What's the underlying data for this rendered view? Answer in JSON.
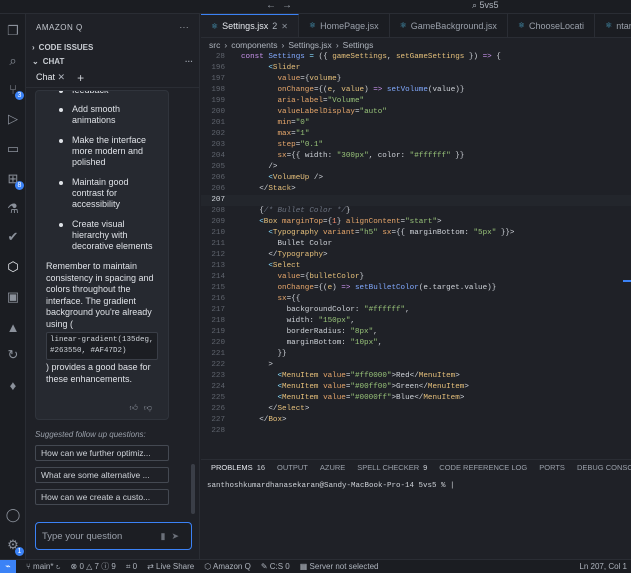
{
  "titlebar": {
    "search": "5vs5",
    "nav_back": "←",
    "nav_fwd": "→"
  },
  "sidebar": {
    "title": "AMAZON Q",
    "sections": [
      {
        "label": "CODE ISSUES"
      },
      {
        "label": "CHAT"
      }
    ],
    "chat_tab": "Chat"
  },
  "chat": {
    "bullets_partial": "feedback",
    "bullets": [
      "Add smooth animations",
      "Make the interface more modern and polished",
      "Maintain good contrast for accessibility",
      "Create visual hierarchy with decorative elements"
    ],
    "paragraph1": "Remember to maintain consistency in spacing and colors throughout the interface. The gradient background you're already using (",
    "code": "linear-gradient(135deg, #263550, #AF47D2)",
    "paragraph2": ") provides a good base for these enhancements.",
    "suggest_label": "Suggested follow up questions:",
    "suggestions": [
      "How can we further optimiz...",
      "What are some alternative ...",
      "How can we create a custo..."
    ],
    "input_placeholder": "Type your question"
  },
  "editor": {
    "tabs": [
      {
        "label": "Settings.jsx",
        "badge": "2",
        "active": true
      },
      {
        "label": "HomePage.jsx"
      },
      {
        "label": "GameBackground.jsx"
      },
      {
        "label": "ChooseLocati"
      },
      {
        "label": "ntary.jsx"
      }
    ],
    "breadcrumb": [
      "src",
      "components",
      "Settings.jsx",
      "Settings"
    ],
    "lines": [
      {
        "n": "28",
        "html": "<span class=\"kw\">const</span> <span class=\"fn\">Settings</span> <span class=\"pn\">=</span> ({ <span class=\"va\">gameSettings</span>, <span class=\"va\">setGameSettings</span> }) <span class=\"kw\">=&gt;</span> {"
      },
      {
        "n": "196",
        "html": "      <span class=\"pn\">&lt;</span><span class=\"tg\">Slider</span>"
      },
      {
        "n": "197",
        "html": "        <span class=\"at\">value</span>={<span class=\"va\">volume</span>}"
      },
      {
        "n": "198",
        "html": "        <span class=\"at\">onChange</span>={(<span class=\"va\">e</span>, <span class=\"va\">value</span>) <span class=\"kw\">=&gt;</span> <span class=\"fn\">setVolume</span>(value)}"
      },
      {
        "n": "199",
        "html": "        <span class=\"at\">aria-label</span>=<span class=\"st\">\"Volume\"</span>"
      },
      {
        "n": "200",
        "html": "        <span class=\"at\">valueLabelDisplay</span>=<span class=\"st\">\"auto\"</span>"
      },
      {
        "n": "201",
        "html": "        <span class=\"at\">min</span>=<span class=\"st\">\"0\"</span>"
      },
      {
        "n": "202",
        "html": "        <span class=\"at\">max</span>=<span class=\"st\">\"1\"</span>"
      },
      {
        "n": "203",
        "html": "        <span class=\"at\">step</span>=<span class=\"st\">\"0.1\"</span>"
      },
      {
        "n": "204",
        "html": "        <span class=\"at\">sx</span>={{ width: <span class=\"st\">\"300px\"</span>, color: <span class=\"st\">\"#ffffff\"</span> }}"
      },
      {
        "n": "205",
        "html": "      /&gt;"
      },
      {
        "n": "206",
        "html": "      <span class=\"pn\">&lt;</span><span class=\"tg\">VolumeUp</span> /&gt;"
      },
      {
        "n": "206",
        "html": "    &lt;/<span class=\"tg\">Stack</span>&gt;"
      },
      {
        "n": "207",
        "html": "",
        "cur": true
      },
      {
        "n": "208",
        "html": "    {<span class=\"cm\">/* Bullet Color */</span>}"
      },
      {
        "n": "209",
        "html": "    <span class=\"pn\">&lt;</span><span class=\"tg\">Box</span> <span class=\"at\">marginTop</span>={<span class=\"br\">1</span>} <span class=\"at\">alignContent</span>=<span class=\"st\">\"start\"</span>&gt;"
      },
      {
        "n": "210",
        "html": "      <span class=\"pn\">&lt;</span><span class=\"tg\">Typography</span> <span class=\"at\">variant</span>=<span class=\"st\">\"h5\"</span> <span class=\"at\">sx</span>={{ marginBottom: <span class=\"st\">\"5px\"</span> }}&gt;"
      },
      {
        "n": "211",
        "html": "        Bullet Color"
      },
      {
        "n": "212",
        "html": "      &lt;/<span class=\"tg\">Typography</span>&gt;"
      },
      {
        "n": "213",
        "html": "      <span class=\"pn\">&lt;</span><span class=\"tg\">Select</span>"
      },
      {
        "n": "214",
        "html": "        <span class=\"at\">value</span>={<span class=\"va\">bulletColor</span>}"
      },
      {
        "n": "215",
        "html": "        <span class=\"at\">onChange</span>={(<span class=\"va\">e</span>) <span class=\"kw\">=&gt;</span> <span class=\"fn\">setBulletColor</span>(e.target.value)}"
      },
      {
        "n": "216",
        "html": "        <span class=\"at\">sx</span>={{"
      },
      {
        "n": "217",
        "html": "          backgroundColor: <span class=\"st\">\"#ffffff\"</span>,"
      },
      {
        "n": "218",
        "html": "          width: <span class=\"st\">\"150px\"</span>,"
      },
      {
        "n": "219",
        "html": "          borderRadius: <span class=\"st\">\"8px\"</span>,"
      },
      {
        "n": "220",
        "html": "          marginBottom: <span class=\"st\">\"10px\"</span>,"
      },
      {
        "n": "221",
        "html": "        }}"
      },
      {
        "n": "222",
        "html": "      &gt;"
      },
      {
        "n": "223",
        "html": "        <span class=\"pn\">&lt;</span><span class=\"tg\">MenuItem</span> <span class=\"at\">value</span>=<span class=\"st\">\"#ff0000\"</span>&gt;Red&lt;/<span class=\"tg\">MenuItem</span>&gt;"
      },
      {
        "n": "224",
        "html": "        <span class=\"pn\">&lt;</span><span class=\"tg\">MenuItem</span> <span class=\"at\">value</span>=<span class=\"st\">\"#00ff00\"</span>&gt;Green&lt;/<span class=\"tg\">MenuItem</span>&gt;"
      },
      {
        "n": "225",
        "html": "        <span class=\"pn\">&lt;</span><span class=\"tg\">MenuItem</span> <span class=\"at\">value</span>=<span class=\"st\">\"#0000ff\"</span>&gt;Blue&lt;/<span class=\"tg\">MenuItem</span>&gt;"
      },
      {
        "n": "226",
        "html": "      &lt;/<span class=\"tg\">Select</span>&gt;"
      },
      {
        "n": "227",
        "html": "    &lt;/<span class=\"tg\">Box</span>&gt;"
      },
      {
        "n": "228",
        "html": ""
      }
    ]
  },
  "panel": {
    "tabs": [
      {
        "label": "PROBLEMS",
        "count": "16",
        "active": true
      },
      {
        "label": "OUTPUT"
      },
      {
        "label": "AZURE"
      },
      {
        "label": "SPELL CHECKER",
        "count": "9"
      },
      {
        "label": "CODE REFERENCE LOG"
      },
      {
        "label": "PORTS"
      },
      {
        "label": "DEBUG CONSOLE"
      }
    ],
    "terminal_line": "santhoshkumardhanasekaran@Sandy-MacBook-Pro-14 5vs5 % |"
  },
  "status": {
    "branch": "main*",
    "errors": "0",
    "warnings": "7",
    "info": "9",
    "ports": "0",
    "live_share": "Live Share",
    "amazon_q": "Amazon Q",
    "cs": "C:S 0",
    "server": "Server not selected",
    "position": "Ln 207, Col 1"
  }
}
